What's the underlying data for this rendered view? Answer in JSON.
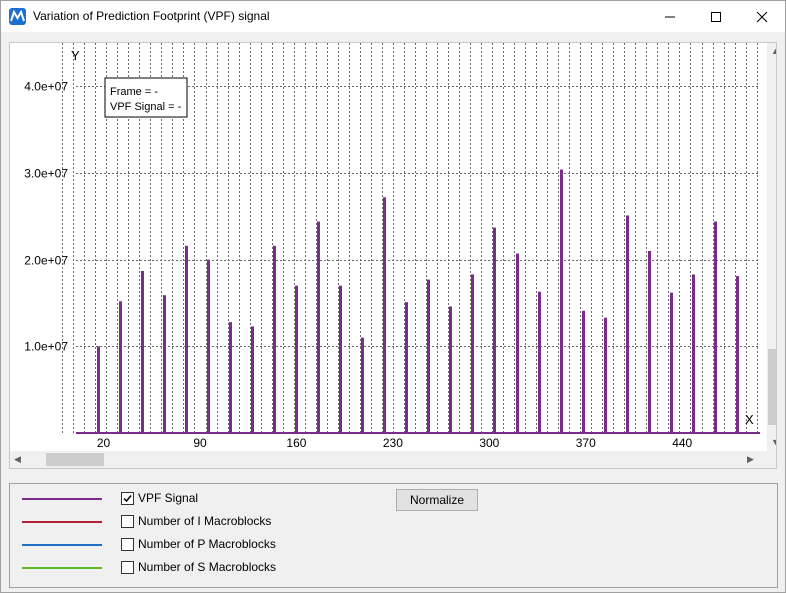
{
  "window": {
    "title": "Variation of Prediction Footprint (VPF) signal"
  },
  "plot": {
    "y_axis_label": "Y",
    "x_axis_label": "X",
    "info_box": {
      "frame": "Frame = -",
      "vpf_signal": "VPF Signal = -"
    }
  },
  "chart_data": {
    "type": "bar",
    "xlabel": "X",
    "ylabel": "Y",
    "xlim": [
      0,
      495
    ],
    "ylim": [
      0,
      45000000
    ],
    "x_ticks": [
      "20",
      "90",
      "160",
      "230",
      "300",
      "370",
      "440"
    ],
    "y_ticks": [
      "1.0e+07",
      "2.0e+07",
      "3.0e+07",
      "4.0e+07"
    ],
    "grid": true,
    "series": [
      {
        "name": "VPF Signal",
        "color": "#7b2d8b",
        "x": [
          15,
          31,
          47,
          63,
          79,
          95,
          111,
          127,
          143,
          159,
          175,
          191,
          207,
          223,
          239,
          255,
          271,
          287,
          303,
          319,
          335,
          351,
          367,
          383,
          399,
          415,
          431,
          447,
          463,
          479
        ],
        "values": [
          10000000,
          15200000,
          18700000,
          15900000,
          21600000,
          20000000,
          12800000,
          12300000,
          21600000,
          17000000,
          24400000,
          17000000,
          11000000,
          27200000,
          15100000,
          17700000,
          14600000,
          18300000,
          23700000,
          20700000,
          16300000,
          30400000,
          14100000,
          13300000,
          25100000,
          21000000,
          16200000,
          18300000,
          24400000,
          18100000
        ]
      },
      {
        "name": "Number of I Macroblocks",
        "color": "#b22234",
        "values": []
      },
      {
        "name": "Number of P Macroblocks",
        "color": "#1f6fc5",
        "values": []
      },
      {
        "name": "Number of S Macroblocks",
        "color": "#5cb82e",
        "values": []
      }
    ]
  },
  "legend": {
    "items": [
      {
        "label": "VPF Signal",
        "checked": true,
        "color": "#7b2d8b"
      },
      {
        "label": "Number of I Macroblocks",
        "checked": false,
        "color": "#b22234"
      },
      {
        "label": "Number of P Macroblocks",
        "checked": false,
        "color": "#1f6fc5"
      },
      {
        "label": "Number of S Macroblocks",
        "checked": false,
        "color": "#5cb82e"
      }
    ],
    "normalize_label": "Normalize"
  }
}
